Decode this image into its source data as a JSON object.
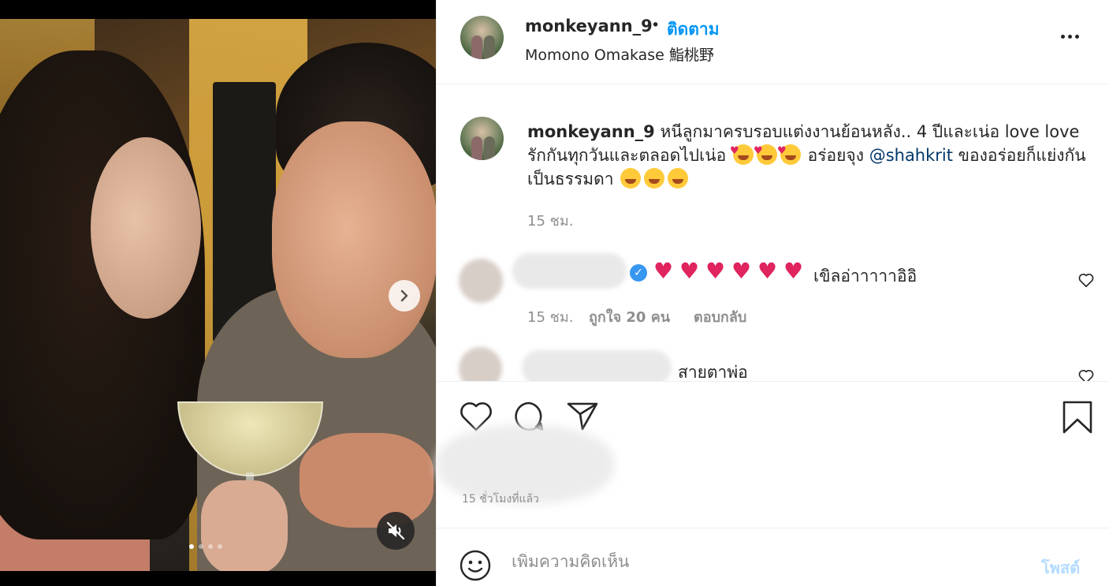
{
  "post": {
    "username": "monkeyann_9",
    "bullet": "•",
    "follow_label": "ติดตาม",
    "location": "Momono Omakase 鮨桃野",
    "media": {
      "slide_count": 4,
      "active_slide": 1
    }
  },
  "caption": {
    "username": "monkeyann_9",
    "text_1": "หนีลูกมาครบรอบแต่งงานย้อนหลัง.. 4 ปีและเน่อ love love รักกันทุกวันและตลอดไปเน่อ",
    "text_2": "อร่อยจุง",
    "mention": "@shahkrit",
    "text_3": "ของอร่อยก็แย่งกันเป็นธรรมดา",
    "time": "15 ชม."
  },
  "comments": [
    {
      "username_blurred": true,
      "verified": true,
      "heart_count": 6,
      "text": "เขิลอ่าาาาาอิอิ",
      "time": "15 ชม.",
      "likes": "ถูกใจ 20 คน",
      "reply_label": "ตอบกลับ"
    },
    {
      "username_blurred": true,
      "text": "สายตาพ่อ"
    }
  ],
  "actions": {
    "like_icon": "heart-icon",
    "comment_icon": "comment-icon",
    "share_icon": "paper-plane-icon",
    "save_icon": "bookmark-icon",
    "ago": "15 ชั่วโมงที่แล้ว"
  },
  "add_comment": {
    "placeholder": "เพิ่มความคิดเห็น",
    "post_label": "โพสต์",
    "emoji_icon": "smiley-icon"
  },
  "colors": {
    "accent": "#0095f6",
    "mention": "#00376b",
    "muted": "#8e8e8e",
    "heart": "#e0245e",
    "post_disabled": "#b3dbff"
  }
}
